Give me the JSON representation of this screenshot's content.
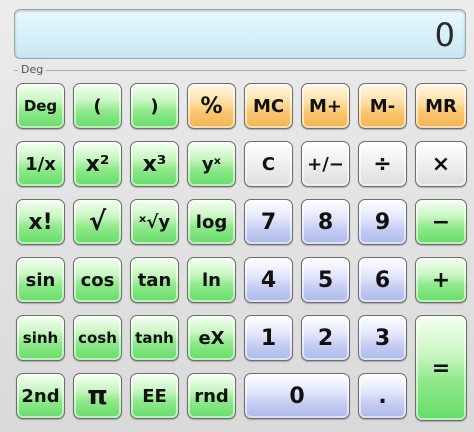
{
  "display": {
    "value": "0"
  },
  "mode": {
    "label": "Deg"
  },
  "buttons": {
    "deg": "Deg",
    "lparen": "(",
    "rparen": ")",
    "percent": "%",
    "mc": "MC",
    "mplus": "M+",
    "mminus": "M-",
    "mr": "MR",
    "recip": "1/x",
    "x2": "x²",
    "x3": "x³",
    "yx": "yˣ",
    "clear": "C",
    "plusminus": "+/−",
    "divide": "÷",
    "multiply": "×",
    "fact": "x!",
    "sqrt": "√",
    "xroot": "ˣ√y",
    "log": "log",
    "seven": "7",
    "eight": "8",
    "nine": "9",
    "minus": "−",
    "sin": "sin",
    "cos": "cos",
    "tan": "tan",
    "ln": "ln",
    "four": "4",
    "five": "5",
    "six": "6",
    "plus": "+",
    "sinh": "sinh",
    "cosh": "cosh",
    "tanh": "tanh",
    "ex": "eX",
    "one": "1",
    "two": "2",
    "three": "3",
    "equals": "=",
    "second": "2nd",
    "pi": "π",
    "ee": "EE",
    "rnd": "rnd",
    "zero": "0",
    "dot": "."
  }
}
